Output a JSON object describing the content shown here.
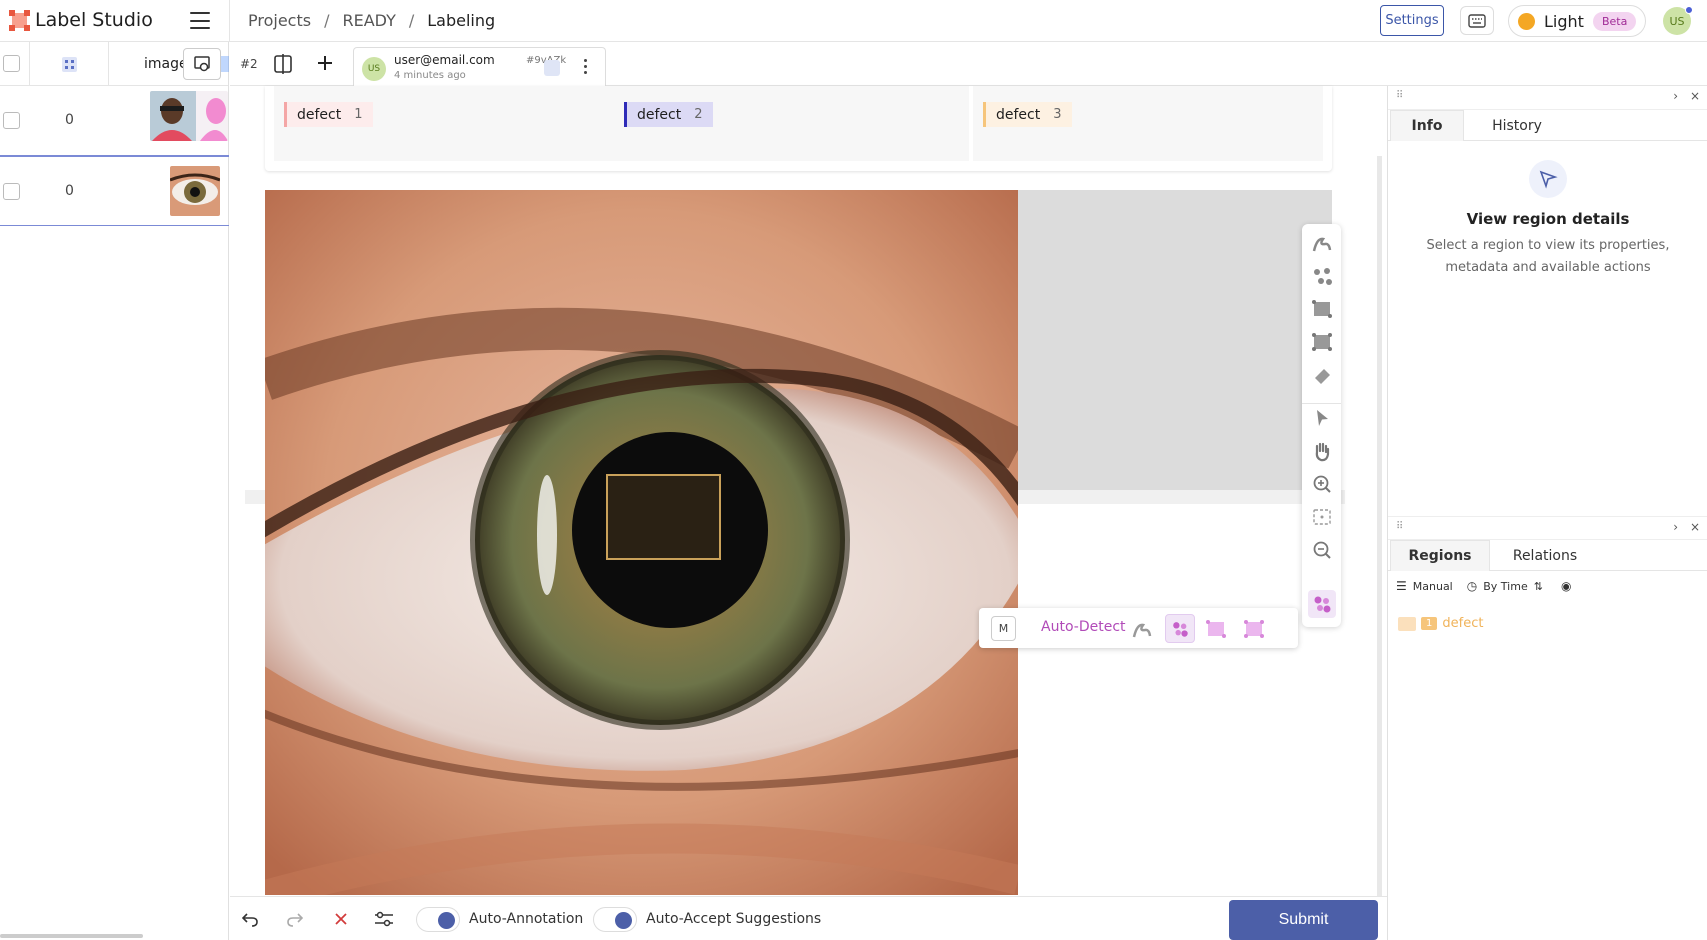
{
  "app": {
    "name": "Label Studio"
  },
  "breadcrumb": {
    "projects": "Projects",
    "sep1": "/",
    "project": "READY",
    "sep2": "/",
    "current": "Labeling"
  },
  "header": {
    "settings_label": "Settings",
    "theme_label": "Light",
    "beta_label": "Beta",
    "avatar_initials": "US"
  },
  "left_panel": {
    "column_image": "image",
    "rows": [
      {
        "count": "0",
        "thumb": "two-people-thumbnail"
      },
      {
        "count": "0",
        "thumb": "eye-thumbnail"
      }
    ]
  },
  "task": {
    "number": "#2",
    "annotation": {
      "avatar": "US",
      "user": "user@email.com",
      "id": "#9vAZk",
      "time": "4 minutes ago"
    }
  },
  "labels": [
    {
      "name": "defect",
      "key": "1",
      "color": "#f4a6a6"
    },
    {
      "name": "defect",
      "key": "2",
      "color": "#2e2bb8"
    },
    {
      "name": "defect",
      "key": "3",
      "color": "#f6c57b"
    }
  ],
  "auto_detect": {
    "key": "M",
    "label": "Auto-Detect"
  },
  "bottom": {
    "auto_annotation": "Auto-Annotation",
    "auto_accept": "Auto-Accept Suggestions",
    "submit": "Submit"
  },
  "right_panel": {
    "tab_info": "Info",
    "tab_history": "History",
    "info_title": "View region details",
    "info_desc_1": "Select a region to view its properties,",
    "info_desc_2": "metadata and available actions",
    "tab_regions": "Regions",
    "tab_relations": "Relations",
    "sort_manual": "Manual",
    "sort_by_time": "By Time",
    "region_number": "1",
    "region_label": "defect"
  },
  "colors": {
    "accent": "#4c5fa8",
    "brand": "#e8573f",
    "auto_detect": "#b14bb8"
  }
}
